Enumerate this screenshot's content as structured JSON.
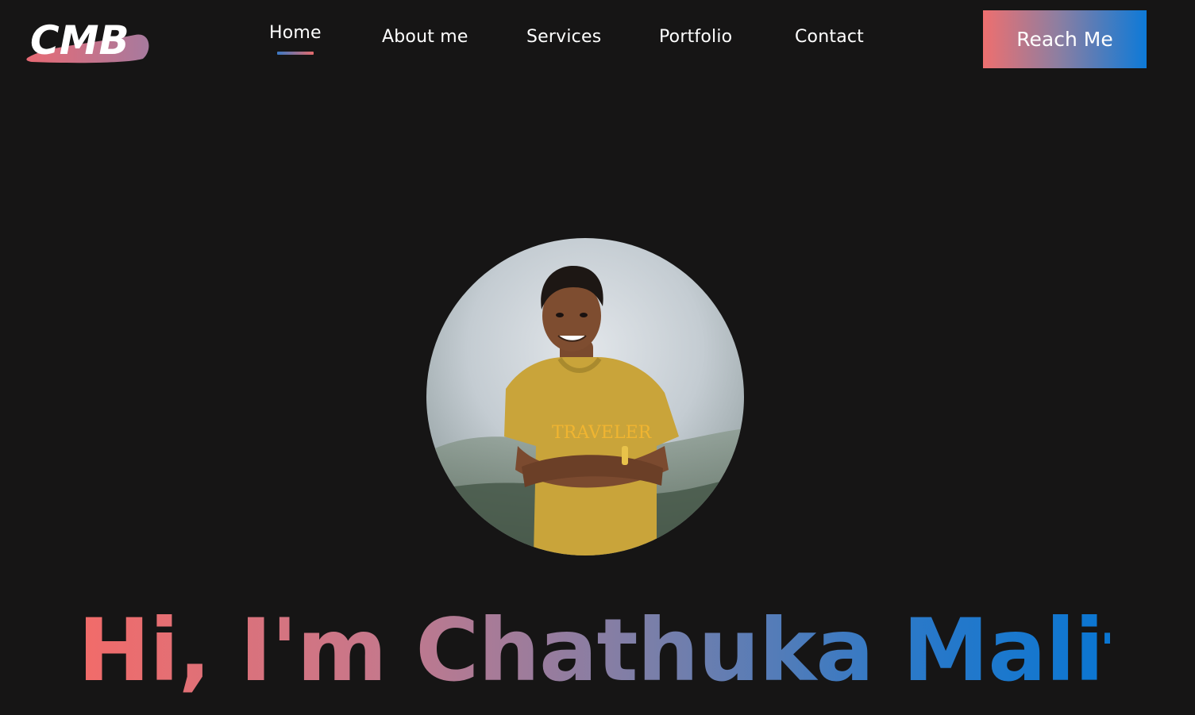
{
  "logo": {
    "text": "CMB"
  },
  "nav": {
    "items": [
      {
        "label": "Home",
        "active": true
      },
      {
        "label": "About me",
        "active": false
      },
      {
        "label": "Services",
        "active": false
      },
      {
        "label": "Portfolio",
        "active": false
      },
      {
        "label": "Contact",
        "active": false
      }
    ],
    "cta_label": "Reach Me"
  },
  "hero": {
    "shirt_text": "TRAVELER",
    "headline": "Hi, I'm Chathuka Malitha,"
  },
  "colors": {
    "background": "#161515",
    "accent_coral": "#ee6f6f",
    "accent_blue": "#0d7ad8",
    "shirt_mustard": "#c9a43a"
  }
}
